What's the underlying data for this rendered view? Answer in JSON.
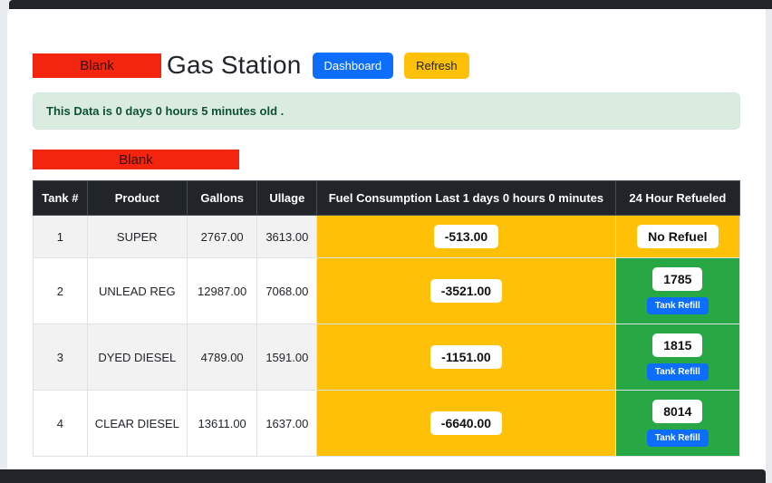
{
  "header": {
    "redacted": "Blank",
    "title": "Gas Station",
    "dashboard_button": "Dashboard",
    "refresh_button": "Refresh"
  },
  "alert": {
    "message": "This Data is 0 days 0 hours 5 minutes old ."
  },
  "section": {
    "redacted": "Blank"
  },
  "table": {
    "headers": {
      "tank": "Tank #",
      "product": "Product",
      "gallons": "Gallons",
      "ullage": "Ullage",
      "consumption": "Fuel Consumption Last 1 days 0 hours 0 minutes",
      "refueled": "24 Hour Refueled"
    },
    "rows": [
      {
        "tank": "1",
        "product": "SUPER",
        "gallons": "2767.00",
        "ullage": "3613.00",
        "consumption": "-513.00",
        "refueled": "No Refuel"
      },
      {
        "tank": "2",
        "product": "UNLEAD REG",
        "gallons": "12987.00",
        "ullage": "7068.00",
        "consumption": "-3521.00",
        "refueled": "1785",
        "refill_label": "Tank Refill"
      },
      {
        "tank": "3",
        "product": "DYED DIESEL",
        "gallons": "4789.00",
        "ullage": "1591.00",
        "consumption": "-1151.00",
        "refueled": "1815",
        "refill_label": "Tank Refill"
      },
      {
        "tank": "4",
        "product": "CLEAR DIESEL",
        "gallons": "13611.00",
        "ullage": "1637.00",
        "consumption": "-6640.00",
        "refueled": "8014",
        "refill_label": "Tank Refill"
      }
    ]
  },
  "colors": {
    "primary": "#0d6efd",
    "warning": "#ffc107",
    "success": "#28a745",
    "redaction": "#f4250f",
    "alert_bg": "#d9ecdf",
    "alert_text": "#0f5132",
    "dark": "#212529"
  }
}
